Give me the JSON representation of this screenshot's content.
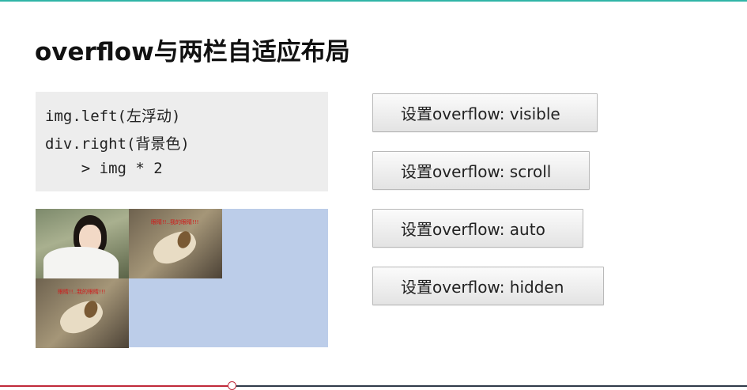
{
  "slide": {
    "title": "overflow与两栏自适应布局",
    "accent_color": "#2fb5a7"
  },
  "code": {
    "lines": [
      "img.left(左浮动)",
      "div.right(背景色)",
      "    > img * 2"
    ]
  },
  "demo": {
    "background_color": "#bccde9",
    "photos": [
      {
        "icon": "girl-photo"
      },
      {
        "icon": "dog-photo",
        "caption": "眼睛!!..我的眼睛!!!"
      },
      {
        "icon": "dog-photo",
        "caption": "眼睛!!..我的眼睛!!!"
      }
    ]
  },
  "buttons": [
    {
      "label": "设置overflow: visible"
    },
    {
      "label": "设置overflow: scroll"
    },
    {
      "label": "设置overflow: auto"
    },
    {
      "label": "设置overflow: hidden"
    }
  ],
  "video": {
    "progress": 0.31,
    "played_color": "#c0293a",
    "track_color": "#2f3a4a"
  }
}
